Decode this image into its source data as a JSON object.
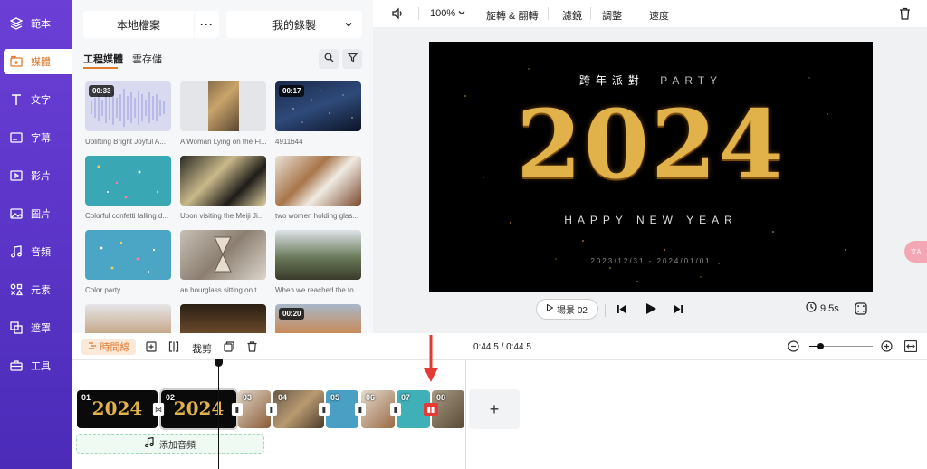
{
  "nav": {
    "items": [
      {
        "label": "範本",
        "icon": "template-icon"
      },
      {
        "label": "媒體",
        "icon": "media-folder-icon",
        "active": true
      },
      {
        "label": "文字",
        "icon": "text-icon"
      },
      {
        "label": "字幕",
        "icon": "subtitle-icon"
      },
      {
        "label": "影片",
        "icon": "video-icon"
      },
      {
        "label": "圖片",
        "icon": "image-icon"
      },
      {
        "label": "音頻",
        "icon": "music-icon"
      },
      {
        "label": "元素",
        "icon": "elements-icon"
      },
      {
        "label": "遮罩",
        "icon": "mask-icon"
      },
      {
        "label": "工具",
        "icon": "toolbox-icon"
      }
    ]
  },
  "panel": {
    "local_files": "本地檔案",
    "more": "···",
    "recordings": "我的錄製",
    "tabs": [
      "工程媒體",
      "雲存儲"
    ],
    "media": [
      {
        "caption": "Uplifting Bright Joyful A...",
        "duration": "00:33",
        "kind": "audio"
      },
      {
        "caption": "A Woman Lying on the Fl...",
        "duration": "",
        "kind": "photo"
      },
      {
        "caption": "4911644",
        "duration": "00:17",
        "kind": "stars"
      },
      {
        "caption": "Colorful confetti falling d...",
        "duration": "",
        "kind": "confetti"
      },
      {
        "caption": "Upon visiting the Meiji Ji...",
        "duration": "",
        "kind": "plaques"
      },
      {
        "caption": "two women holding glas...",
        "duration": "",
        "kind": "party"
      },
      {
        "caption": "Color party",
        "duration": "",
        "kind": "confetti2"
      },
      {
        "caption": "an hourglass sitting on t...",
        "duration": "",
        "kind": "hourglass"
      },
      {
        "caption": "When we reached the to...",
        "duration": "",
        "kind": "group"
      },
      {
        "caption": "",
        "duration": "",
        "kind": "person"
      },
      {
        "caption": "",
        "duration": "",
        "kind": "dark"
      },
      {
        "caption": "",
        "duration": "00:20",
        "kind": "sunset"
      }
    ]
  },
  "topbar": {
    "zoom": "100%",
    "rotate_flip": "旋轉 & 翻轉",
    "filter": "濾鏡",
    "adjust": "調整",
    "speed": "速度"
  },
  "canvas": {
    "line1": "跨年派對",
    "line1b": "PARTY",
    "year": "2024",
    "line2": "HAPPY NEW YEAR",
    "dates": "2023/12/31 - 2024/01/01"
  },
  "player": {
    "scene": "場景 02",
    "duration": "9.5s"
  },
  "timeline": {
    "label": "時間線",
    "crop": "裁剪",
    "time": "0:44.5 / 0:44.5",
    "add_audio": "添加音頻",
    "add": "+",
    "clips": [
      {
        "num": "01",
        "kind": "gold"
      },
      {
        "num": "02",
        "kind": "gold"
      },
      {
        "num": "03",
        "kind": "party"
      },
      {
        "num": "04",
        "kind": "group"
      },
      {
        "num": "05",
        "kind": "confetti"
      },
      {
        "num": "06",
        "kind": "party"
      },
      {
        "num": "07",
        "kind": "confetti"
      },
      {
        "num": "08",
        "kind": "group"
      }
    ]
  },
  "side_badge": "文A",
  "colors": {
    "accent": "#e07a2e",
    "nav": "#5a34c8",
    "highlight": "#e53935"
  }
}
